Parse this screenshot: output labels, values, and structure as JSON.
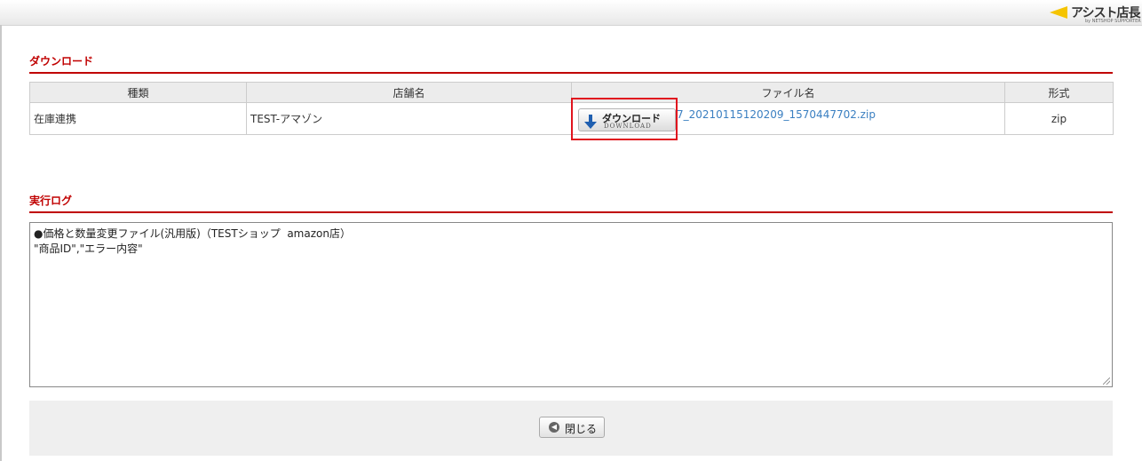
{
  "header": {
    "logo_text": "アシスト店長",
    "logo_sub": "by NETSHOP SUPPORTER"
  },
  "download_section": {
    "title": "ダウンロード",
    "columns": [
      "種類",
      "店舗名",
      "ファイル名",
      "形式"
    ],
    "row": {
      "type": "在庫連携",
      "shop": "TEST-アマゾン",
      "file_name": "7_20210115120209_1570447702.zip",
      "format": "zip"
    },
    "button_label_jp": "ダウンロード",
    "button_label_en": "DOWNLOAD"
  },
  "log_section": {
    "title": "実行ログ",
    "content": "●価格と数量変更ファイル(汎用版)（TESTショップ  amazon店）\n\"商品ID\",\"エラー内容\""
  },
  "footer": {
    "close_label": "閉じる"
  },
  "colors": {
    "accent": "#c00000",
    "link": "#3a7fc1",
    "highlight": "#e0141e"
  }
}
